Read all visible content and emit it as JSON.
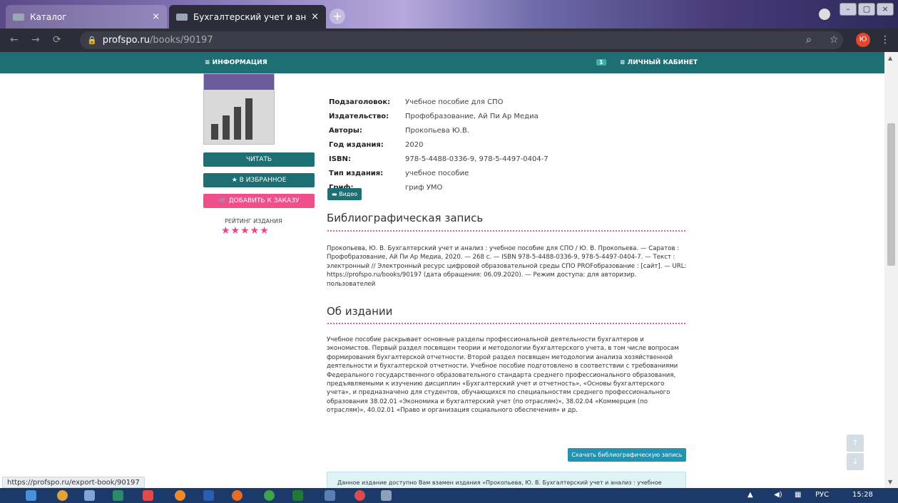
{
  "browser": {
    "tabs": [
      {
        "label": "Каталог",
        "close": "×"
      },
      {
        "label": "Бухгалтерский учет и анализ",
        "close": "×"
      }
    ],
    "new_tab": "+",
    "url_host": "profspo.ru",
    "url_path": "/books/90197",
    "window_buttons": [
      "–",
      "▢",
      "×"
    ],
    "profile_initial": "Ю"
  },
  "site_nav": {
    "info": "≡ ИНФОРМАЦИЯ",
    "badge": "1",
    "cabinet": "≡ ЛИЧНЫЙ КАБИНЕТ"
  },
  "actions": {
    "read": "ЧИТАТЬ",
    "favorite": "★ В ИЗБРАННОЕ",
    "order": "🛒 ДОБАВИТЬ К ЗАКАЗУ",
    "rating_label": "РЕЙТИНГ ИЗДАНИЯ",
    "rating_stars": "★★★★★",
    "rating_value": 5
  },
  "details": [
    {
      "key": "Подзаголовок:",
      "value": "Учебное пособие для СПО"
    },
    {
      "key": "Издательство:",
      "value": "Профобразование, Ай Пи Ар Медиа"
    },
    {
      "key": "Авторы:",
      "value": "Прокопьева Ю.В."
    },
    {
      "key": "Год издания:",
      "value": "2020"
    },
    {
      "key": "ISBN:",
      "value": "978-5-4488-0336-9, 978-5-4497-0404-7"
    },
    {
      "key": "Тип издания:",
      "value": "учебное пособие"
    },
    {
      "key": "Гриф:",
      "value": "гриф УМО"
    }
  ],
  "video_button": "▬ Видео",
  "biblio": {
    "title": "Библиографическая запись",
    "text": "Прокопьева, Ю. В. Бухгалтерский учет и анализ : учебное пособие для СПО / Ю. В. Прокопьева. — Саратов : Профобразование, Ай Пи Ар Медиа, 2020. — 268 c. — ISBN 978-5-4488-0336-9, 978-5-4497-0404-7. — Текст : электронный // Электронный ресурс цифровой образовательной среды СПО PROFобразование : [сайт]. — URL: https://profspo.ru/books/90197 (дата обращения: 06.09.2020). — Режим доступа: для авторизир. пользователей"
  },
  "about": {
    "title": "Об издании",
    "text": "Учебное пособие раскрывает основные разделы профессиональной деятельности бухгалтеров и экономистов. Первый раздел посвящен теории и методологии бухгалтерского учета, в том числе вопросам формирования бухгалтерской отчетности. Второй раздел посвящен методологии анализа хозяйственной деятельности и бухгалтерской отчетности. Учебное пособие подготовлено в соответствии с требованиями Федерального государственного образовательного стандарта среднего профессионального образования, предъявляемыми к изучению дисциплин «Бухгалтерский учет и отчетность», «Основы бухгалтерского учета», и предназначено для студентов, обучающихся по специальностям среднего профессионального образования 38.02.01 «Экономика и бухгалтерский учет (по отраслям)», 38.02.04 «Коммерция (по отраслям)», 40.02.01 «Право и организация социального обеспечения» и др."
  },
  "download_button": "Скачать библиографическую запись",
  "notice": "Данное издание доступно Вам взамен издания «Прокопьева, Ю. В. Бухгалтерский учет и анализ : учебное",
  "status_url": "https://profspo.ru/export-book/90197",
  "scroll_buttons": {
    "up": "↑",
    "down": "↓"
  },
  "taskbar": {
    "lang": "РУС",
    "time": "15:28"
  },
  "colors": {
    "teal": "#1e6f74",
    "pink": "#ef4f8a",
    "blue": "#2294b3"
  }
}
